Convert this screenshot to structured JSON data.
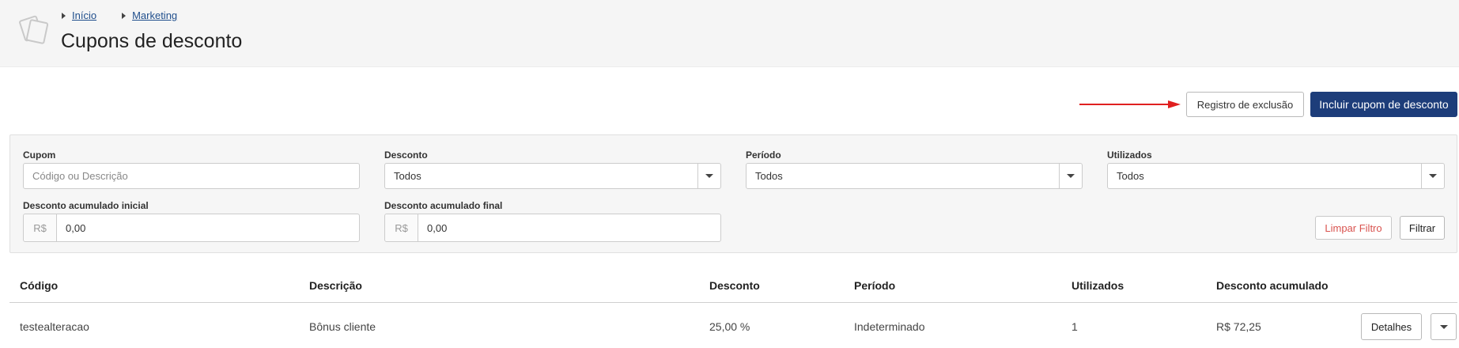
{
  "breadcrumb": {
    "home": "Início",
    "section": "Marketing"
  },
  "page": {
    "title": "Cupons de desconto"
  },
  "actions": {
    "deletion_log": "Registro de exclusão",
    "add_coupon": "Incluir cupom de desconto"
  },
  "filters": {
    "coupon": {
      "label": "Cupom",
      "placeholder": "Código ou Descrição"
    },
    "discount": {
      "label": "Desconto",
      "value": "Todos"
    },
    "period": {
      "label": "Período",
      "value": "Todos"
    },
    "used": {
      "label": "Utilizados",
      "value": "Todos"
    },
    "accum_start": {
      "label": "Desconto acumulado inicial",
      "currency": "R$",
      "value": "0,00"
    },
    "accum_end": {
      "label": "Desconto acumulado final",
      "currency": "R$",
      "value": "0,00"
    },
    "clear": "Limpar Filtro",
    "apply": "Filtrar"
  },
  "table": {
    "headers": [
      "Código",
      "Descrição",
      "Desconto",
      "Período",
      "Utilizados",
      "Desconto acumulado"
    ],
    "rows": [
      {
        "code": "testealteracao",
        "description": "Bônus cliente",
        "discount": "25,00 %",
        "period": "Indeterminado",
        "used": "1",
        "accumulated": "R$ 72,25",
        "details": "Detalhes"
      }
    ]
  },
  "colors": {
    "primary": "#1d3d7a",
    "danger": "#d9534f",
    "arrow": "#e02020",
    "link": "#1f4e8c"
  }
}
